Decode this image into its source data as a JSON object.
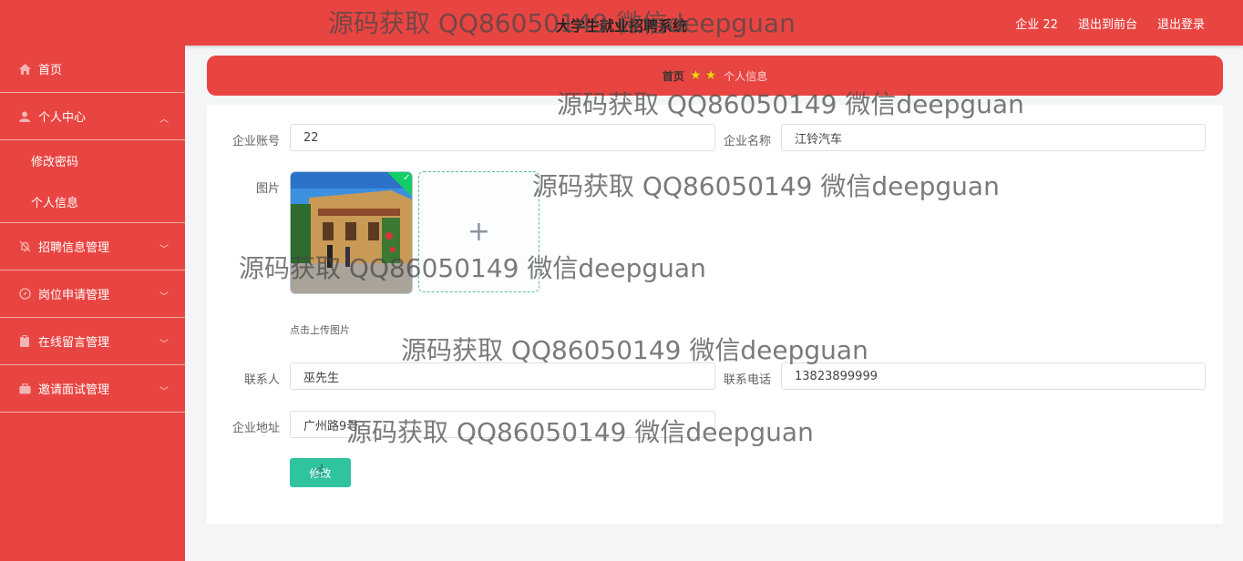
{
  "header": {
    "title": "大学生就业招聘系统",
    "links": [
      "企业 22",
      "退出到前台",
      "退出登录"
    ]
  },
  "sidebar": {
    "items": [
      {
        "label": "首页",
        "icon": "home-icon"
      },
      {
        "label": "个人中心",
        "icon": "user-icon",
        "expanded": true,
        "children": [
          "修改密码",
          "个人信息"
        ]
      },
      {
        "label": "招聘信息管理",
        "icon": "bell-off-icon"
      },
      {
        "label": "岗位申请管理",
        "icon": "compass-icon"
      },
      {
        "label": "在线留言管理",
        "icon": "clipboard-icon"
      },
      {
        "label": "邀请面试管理",
        "icon": "briefcase-icon"
      }
    ]
  },
  "breadcrumb": {
    "home": "首页",
    "current": "个人信息"
  },
  "form": {
    "account_label": "企业账号",
    "account_value": "22",
    "name_label": "企业名称",
    "name_value": "江铃汽车",
    "image_label": "图片",
    "upload_tip": "点击上传图片",
    "contact_label": "联系人",
    "contact_value": "巫先生",
    "phone_label": "联系电话",
    "phone_value": "13823899999",
    "address_label": "企业地址",
    "address_value": "广州路9号",
    "submit_label": "修改"
  },
  "watermark": "源码获取 QQ86050149 微信deepguan",
  "colors": {
    "brand": "#e84542",
    "accent": "#2fc3a0",
    "success": "#13ce66"
  }
}
